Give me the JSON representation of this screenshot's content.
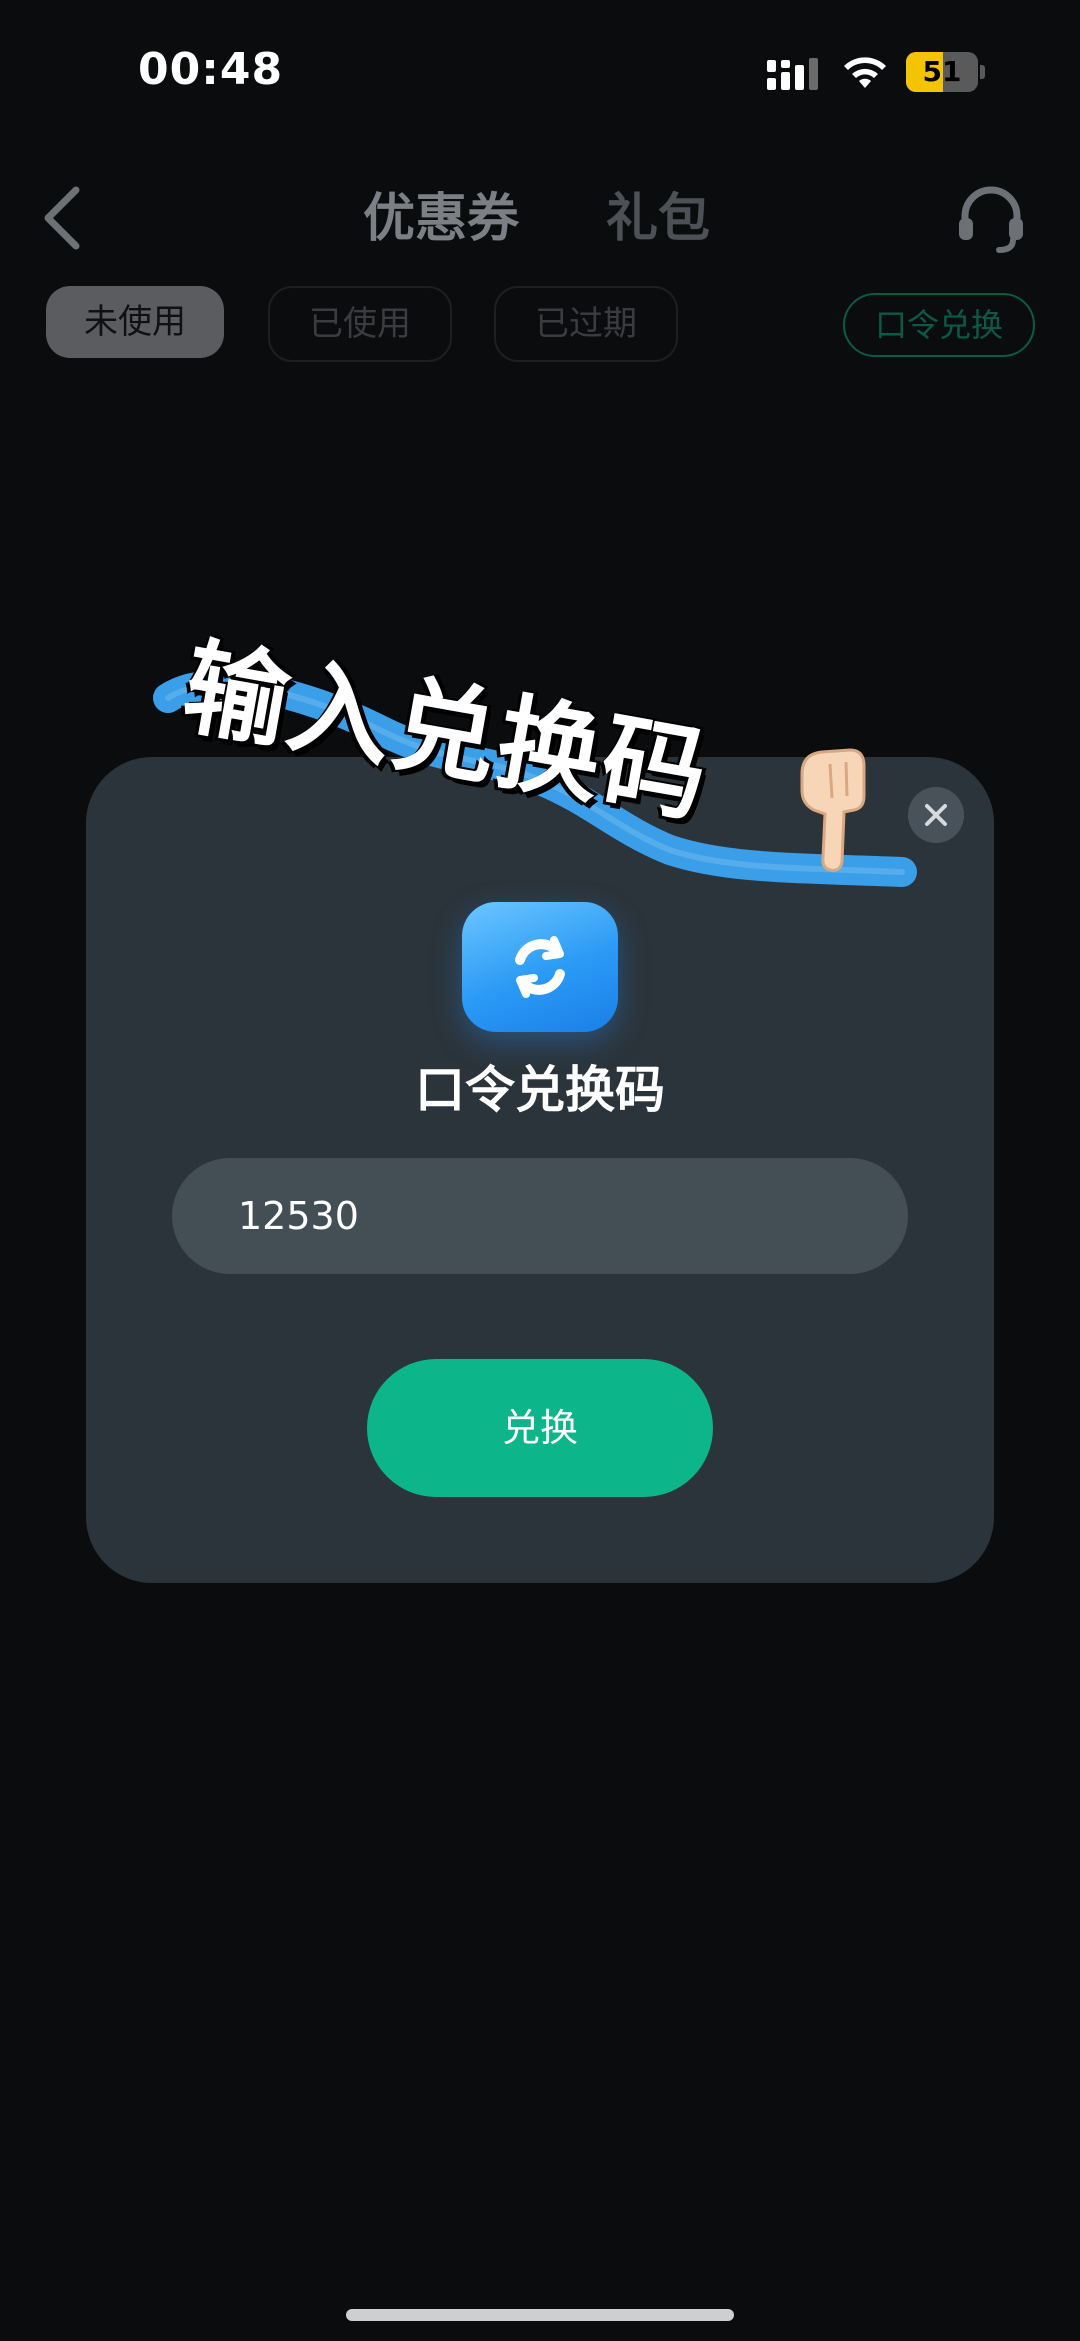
{
  "status_bar": {
    "time": "00:48",
    "battery_level": "51",
    "battery_fraction": 0.51,
    "battery_color": "#f5c400"
  },
  "header": {
    "tabs": [
      {
        "label": "优惠券",
        "active": true
      },
      {
        "label": "礼包",
        "active": false
      }
    ],
    "back_icon": "chevron-left-icon",
    "service_icon": "headset-icon"
  },
  "filters": {
    "unused": "未使用",
    "used": "已使用",
    "expired": "已过期",
    "redeem_code": "口令兑换"
  },
  "banner": {
    "text": "输入兑换码",
    "icon": "pointing-finger-icon"
  },
  "modal": {
    "title": "口令兑换码",
    "code_value": "12530",
    "submit_label": "兑换",
    "accent_color": "#0db58a",
    "icon": "exchange-ticket-icon",
    "close_icon": "close-icon"
  }
}
